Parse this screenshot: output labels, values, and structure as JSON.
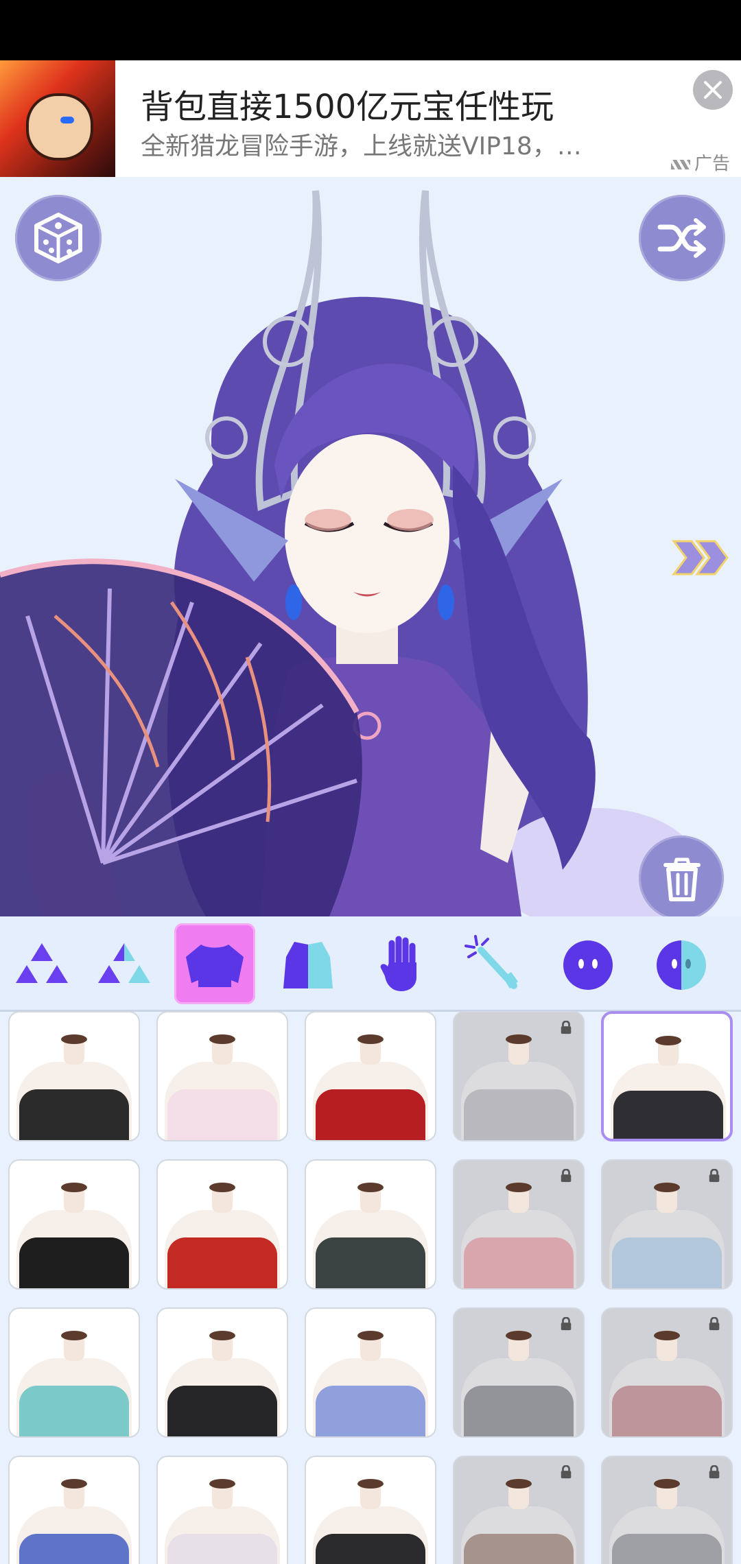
{
  "ad": {
    "title": "背包直接1500亿元宝任性玩",
    "subtitle": "全新猎龙冒险手游，上线就送VIP18，…",
    "tag": "广告"
  },
  "editor": {
    "tool_icons": [
      "dice-icon",
      "shuffle-icon",
      "double-chevron-right-icon",
      "trash-icon"
    ]
  },
  "category_tabs": [
    {
      "icon": "base-triangles-icon",
      "selected": false
    },
    {
      "icon": "color-triangles-icon",
      "selected": false
    },
    {
      "icon": "top-clothing-icon",
      "selected": true
    },
    {
      "icon": "top-color-icon",
      "selected": false
    },
    {
      "icon": "hand-accessory-icon",
      "selected": false
    },
    {
      "icon": "magic-wand-icon",
      "selected": false
    },
    {
      "icon": "face-icon",
      "selected": false
    },
    {
      "icon": "skin-tone-icon",
      "selected": false
    }
  ],
  "items": [
    {
      "style": "black-off-shoulder-chain-collar",
      "locked": false,
      "selected": false,
      "color": "#2b2b2b"
    },
    {
      "style": "white-halter-heart",
      "locked": false,
      "selected": false,
      "color": "#f4dfe8"
    },
    {
      "style": "red-black-high-collar",
      "locked": false,
      "selected": false,
      "color": "#b71e22"
    },
    {
      "style": "grey-frilled-capelet",
      "locked": true,
      "selected": false,
      "color": "#9b9ba2"
    },
    {
      "style": "black-gold-qipao",
      "locked": false,
      "selected": true,
      "color": "#2f2f33"
    },
    {
      "style": "tuxedo-bowtie",
      "locked": false,
      "selected": false,
      "color": "#1e1e1e"
    },
    {
      "style": "red-gold-qipao",
      "locked": false,
      "selected": false,
      "color": "#c42a24"
    },
    {
      "style": "teal-black-halter",
      "locked": false,
      "selected": false,
      "color": "#3c4343"
    },
    {
      "style": "pink-sailor-bow",
      "locked": true,
      "selected": false,
      "color": "#d97a85"
    },
    {
      "style": "blue-striped-bow-frills",
      "locked": true,
      "selected": false,
      "color": "#8fb6d9"
    },
    {
      "style": "teal-ruffle-one-shoulder",
      "locked": false,
      "selected": false,
      "color": "#7cc9c9"
    },
    {
      "style": "black-gold-military-coat",
      "locked": false,
      "selected": false,
      "color": "#262628"
    },
    {
      "style": "blue-frill-bikini",
      "locked": false,
      "selected": false,
      "color": "#8fa0dd"
    },
    {
      "style": "white-pleat-black-collar",
      "locked": true,
      "selected": false,
      "color": "#555a60"
    },
    {
      "style": "red-white-ribbon-blouse",
      "locked": true,
      "selected": false,
      "color": "#a65b62"
    },
    {
      "style": "blue-ribbon-straps",
      "locked": false,
      "selected": false,
      "color": "#5d74c9"
    },
    {
      "style": "white-frill-collar",
      "locked": false,
      "selected": false,
      "color": "#e7e0e8"
    },
    {
      "style": "black-harness-shirt",
      "locked": false,
      "selected": false,
      "color": "#2a2a2c"
    },
    {
      "style": "brown-fur-collar",
      "locked": true,
      "selected": false,
      "color": "#7a5848"
    },
    {
      "style": "grey-suspenders",
      "locked": true,
      "selected": false,
      "color": "#6b6f77"
    }
  ]
}
